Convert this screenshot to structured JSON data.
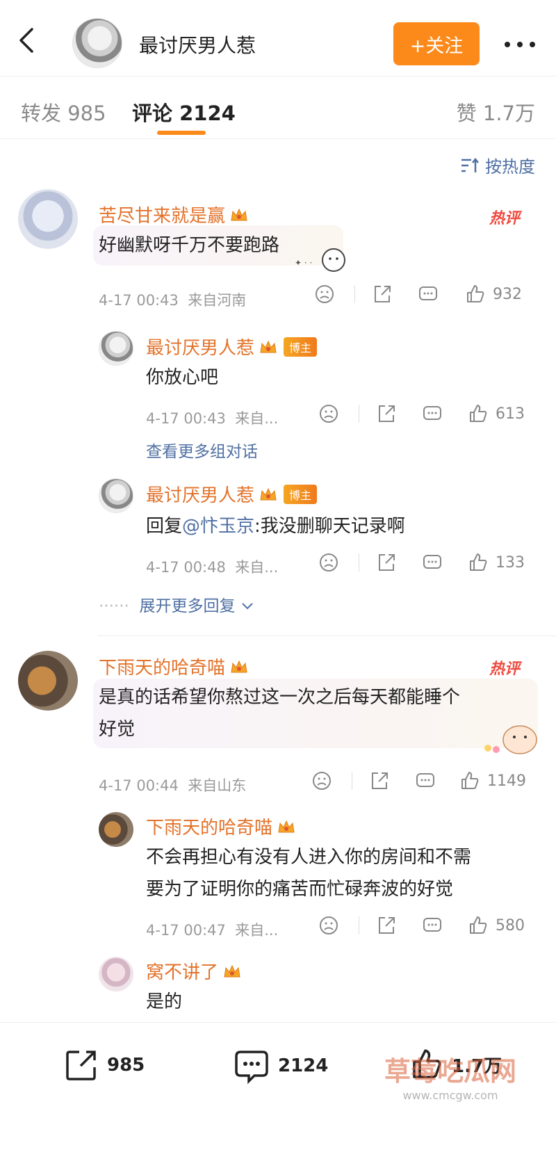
{
  "header": {
    "name": "最讨厌男人惹",
    "follow_label": "+关注"
  },
  "tabs": {
    "forward": "转发 985",
    "comments": "评论 2124",
    "likes": "赞 1.7万"
  },
  "sort_label": "按热度",
  "hot_label": "热评",
  "owner_tag": "博主",
  "comments": [
    {
      "user": "苦尽甘来就是赢",
      "text": "好幽默呀千万不要跑路",
      "time": "4-17 00:43",
      "source": "来自河南",
      "likes": "932",
      "replies": [
        {
          "user": "最讨厌男人惹",
          "text": "你放心吧",
          "time": "4-17 00:43",
          "source": "来自...",
          "likes": "613",
          "more": "查看更多组对话"
        },
        {
          "user": "最讨厌男人惹",
          "reply_prefix": "回复",
          "reply_to": "@忭玉京",
          "text": ":我没删聊天记录啊",
          "time": "4-17 00:48",
          "source": "来自...",
          "likes": "133"
        }
      ],
      "expand": "展开更多回复"
    },
    {
      "user": "下雨天的哈奇喵",
      "text_line1": "是真的话希望你熬过这一次之后每天都能睡个",
      "text_line2": "好觉",
      "time": "4-17 00:44",
      "source": "来自山东",
      "likes": "1149",
      "replies": [
        {
          "user": "下雨天的哈奇喵",
          "text_line1": "不会再担心有没有人进入你的房间和不需",
          "text_line2": "要为了证明你的痛苦而忙碌奔波的好觉",
          "time": "4-17 00:47",
          "source": "来自...",
          "likes": "580"
        },
        {
          "user": "窝不讲了",
          "text": "是的"
        }
      ]
    }
  ],
  "bottom_bar": {
    "forward": "985",
    "comments": "2124",
    "likes": "1.7万"
  },
  "watermark": {
    "text": "草莓吃瓜网",
    "sub": "www.cmcgw.com"
  },
  "colors": {
    "accent": "#fb8a1b",
    "username": "#e3722a",
    "link": "#4f6fa3",
    "hot": "#ee4a3f"
  }
}
